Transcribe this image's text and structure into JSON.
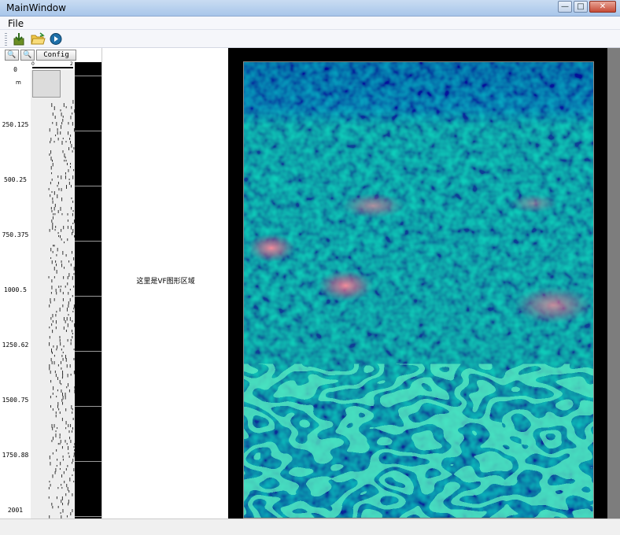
{
  "window": {
    "title": "MainWindow",
    "min": "—",
    "max": "□",
    "close": "✕"
  },
  "menu": {
    "file": "File"
  },
  "toolbar": {
    "icons": [
      "import-icon",
      "open-folder-icon",
      "play-icon"
    ]
  },
  "track": {
    "zoom_in": "🔍",
    "zoom_out": "🔍",
    "config": "Config",
    "unit": "m",
    "scale_min": "0",
    "scale_max": "2",
    "depth_labels": [
      "0",
      "250.125",
      "500.25",
      "750.375",
      "1000.5",
      "1250.62",
      "1500.75",
      "1750.88",
      "2001"
    ]
  },
  "vf": {
    "placeholder": "这里是VF图形区域"
  },
  "colors": {
    "accent": "#a8c6ea",
    "panel": "#000000"
  }
}
